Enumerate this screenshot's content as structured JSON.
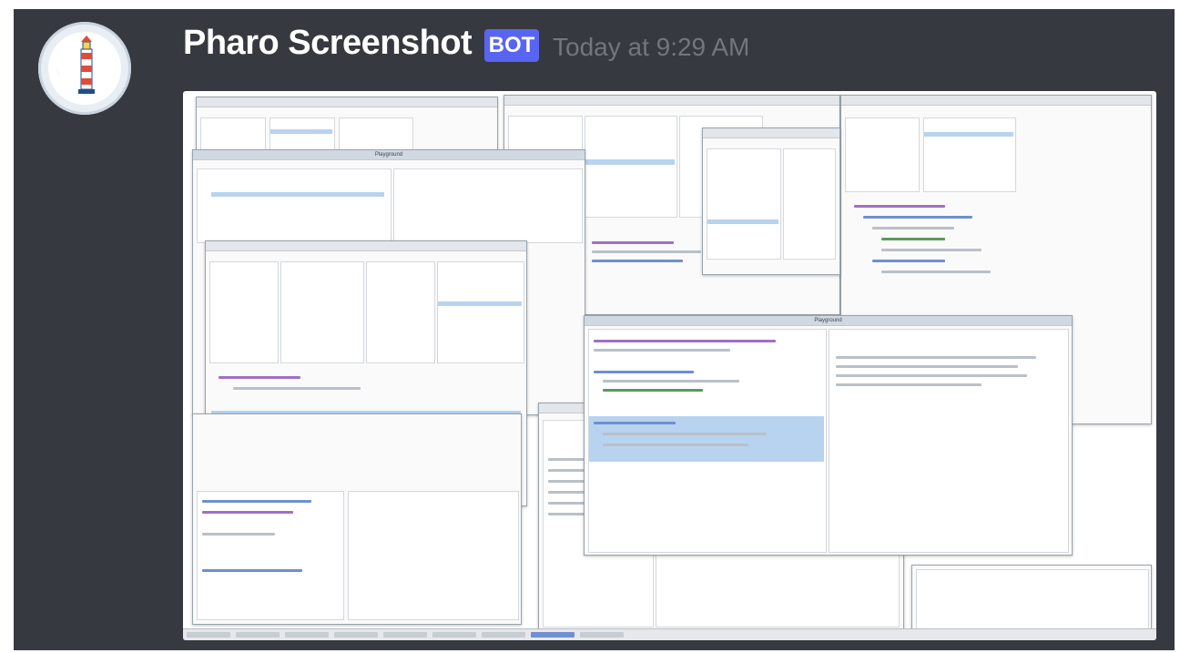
{
  "message": {
    "author": "Pharo Screenshot",
    "badge": "BOT",
    "timestamp": "Today at 9:29 AM"
  },
  "avatar": {
    "icon": "lighthouse-icon",
    "colors": {
      "ring": "#1f6fc2",
      "tower": "#e04b3a"
    }
  },
  "attachment": {
    "windows": [
      "Playground",
      "Playground"
    ]
  },
  "colors": {
    "background": "#36393f",
    "author": "#ffffff",
    "badge": "#5865f2",
    "timestamp": "#72767d"
  }
}
